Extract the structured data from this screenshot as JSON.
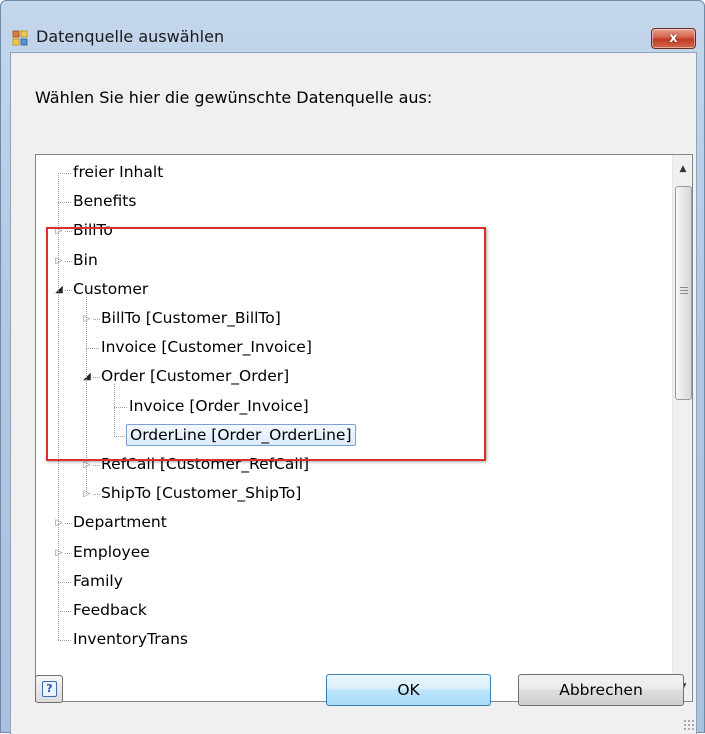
{
  "window": {
    "title": "Datenquelle auswählen",
    "close_label": "x"
  },
  "prompt": "Wählen Sie hier die gewünschte Datenquelle aus:",
  "tree": {
    "items": [
      {
        "label": "freier Inhalt",
        "level": 0,
        "expander": "none"
      },
      {
        "label": "Benefits",
        "level": 0,
        "expander": "none"
      },
      {
        "label": "BillTo",
        "level": 0,
        "expander": "collapsed"
      },
      {
        "label": "Bin",
        "level": 0,
        "expander": "collapsed"
      },
      {
        "label": "Customer",
        "level": 0,
        "expander": "expanded"
      },
      {
        "label": "BillTo [Customer_BillTo]",
        "level": 1,
        "expander": "collapsed"
      },
      {
        "label": "Invoice [Customer_Invoice]",
        "level": 1,
        "expander": "none"
      },
      {
        "label": "Order [Customer_Order]",
        "level": 1,
        "expander": "expanded"
      },
      {
        "label": "Invoice [Order_Invoice]",
        "level": 2,
        "expander": "none"
      },
      {
        "label": "OrderLine [Order_OrderLine]",
        "level": 2,
        "expander": "none",
        "selected": true
      },
      {
        "label": "RefCall [Customer_RefCall]",
        "level": 1,
        "expander": "collapsed"
      },
      {
        "label": "ShipTo [Customer_ShipTo]",
        "level": 1,
        "expander": "collapsed"
      },
      {
        "label": "Department",
        "level": 0,
        "expander": "collapsed"
      },
      {
        "label": "Employee",
        "level": 0,
        "expander": "collapsed"
      },
      {
        "label": "Family",
        "level": 0,
        "expander": "none"
      },
      {
        "label": "Feedback",
        "level": 0,
        "expander": "none"
      },
      {
        "label": "InventoryTrans",
        "level": 0,
        "expander": "none"
      }
    ]
  },
  "buttons": {
    "help_label": "?",
    "ok_label": "OK",
    "cancel_label": "Abbrechen"
  },
  "colors": {
    "highlight_box": "#d9302a",
    "selection_border": "#7da2ce",
    "close_button": "#c03a22"
  },
  "icons": {
    "app": "datasource-dialog-icon",
    "close": "close-icon",
    "help": "help-icon",
    "collapsed": "triangle-right-icon",
    "expanded": "triangle-down-icon"
  }
}
